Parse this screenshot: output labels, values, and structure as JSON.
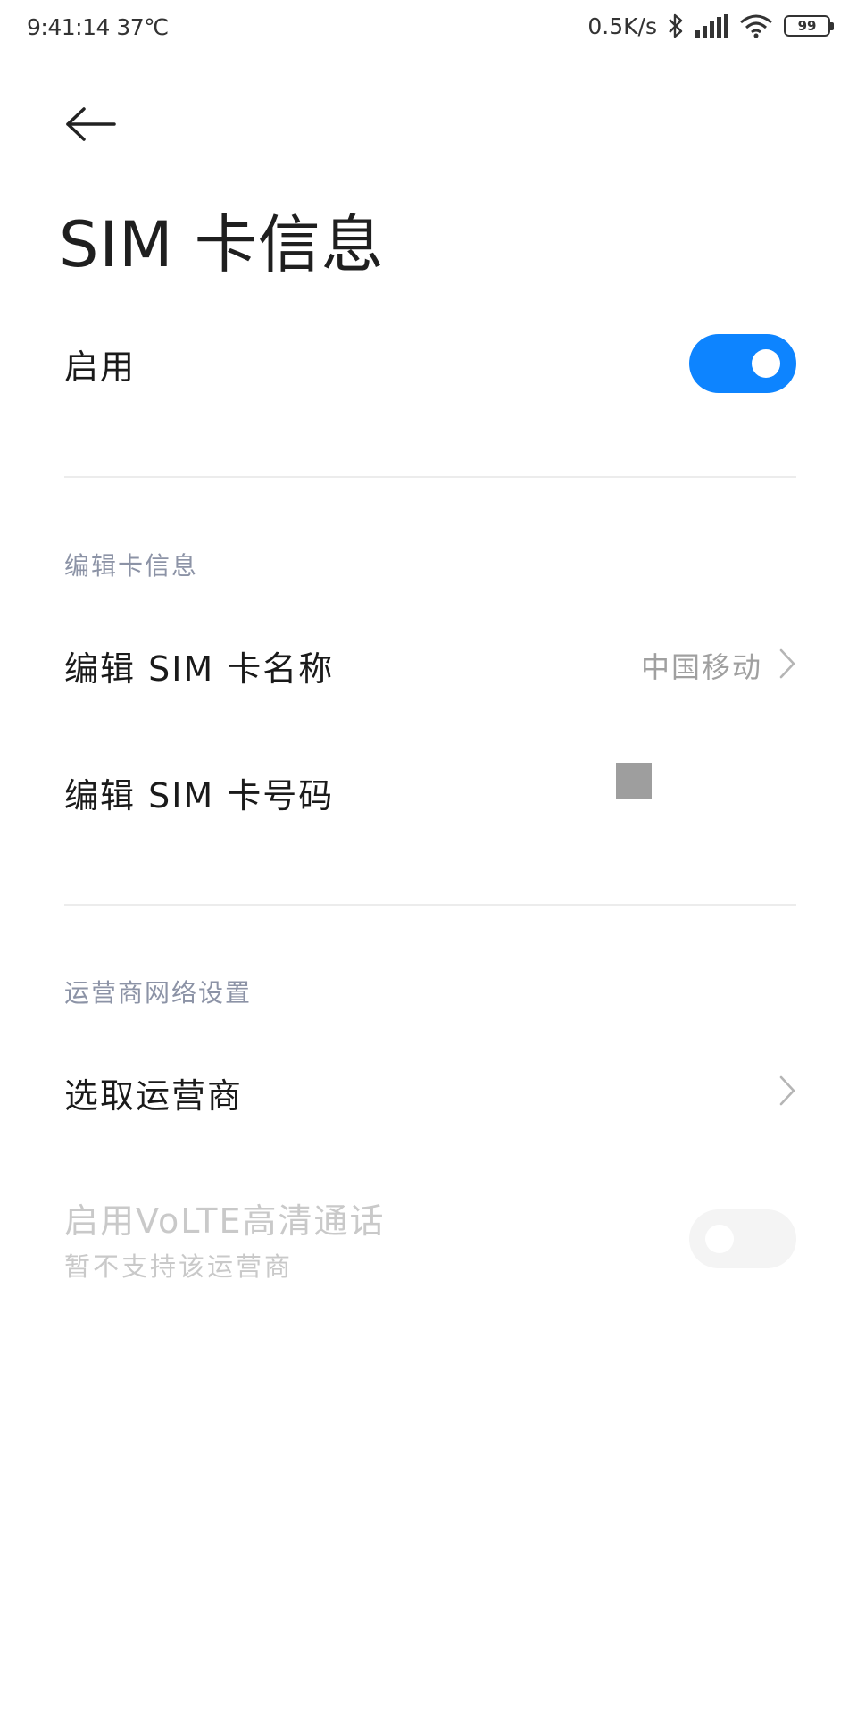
{
  "status_bar": {
    "time_temp": "9:41:14 37℃",
    "net_speed": "0.5K/s",
    "battery": "99",
    "icons": [
      "bluetooth-icon",
      "signal-icon",
      "wifi-icon",
      "battery-icon"
    ]
  },
  "header": {
    "back_icon": "back-arrow-icon",
    "title": "SIM 卡信息"
  },
  "enable": {
    "label": "启用",
    "toggle_on": true,
    "accent_color": "#0d84ff"
  },
  "edit_section": {
    "header": "编辑卡信息",
    "items": [
      {
        "label": "编辑 SIM 卡名称",
        "value": "中国移动",
        "icon": "chevron-right-icon"
      },
      {
        "label": "编辑 SIM 卡号码"
      }
    ]
  },
  "network_section": {
    "header": "运营商网络设置",
    "select_carrier": {
      "label": "选取运营商",
      "icon": "chevron-right-icon"
    },
    "volte": {
      "label": "启用VoLTE高清通话",
      "sublabel": "暂不支持该运营商",
      "toggle_on": false,
      "disabled": true
    }
  }
}
